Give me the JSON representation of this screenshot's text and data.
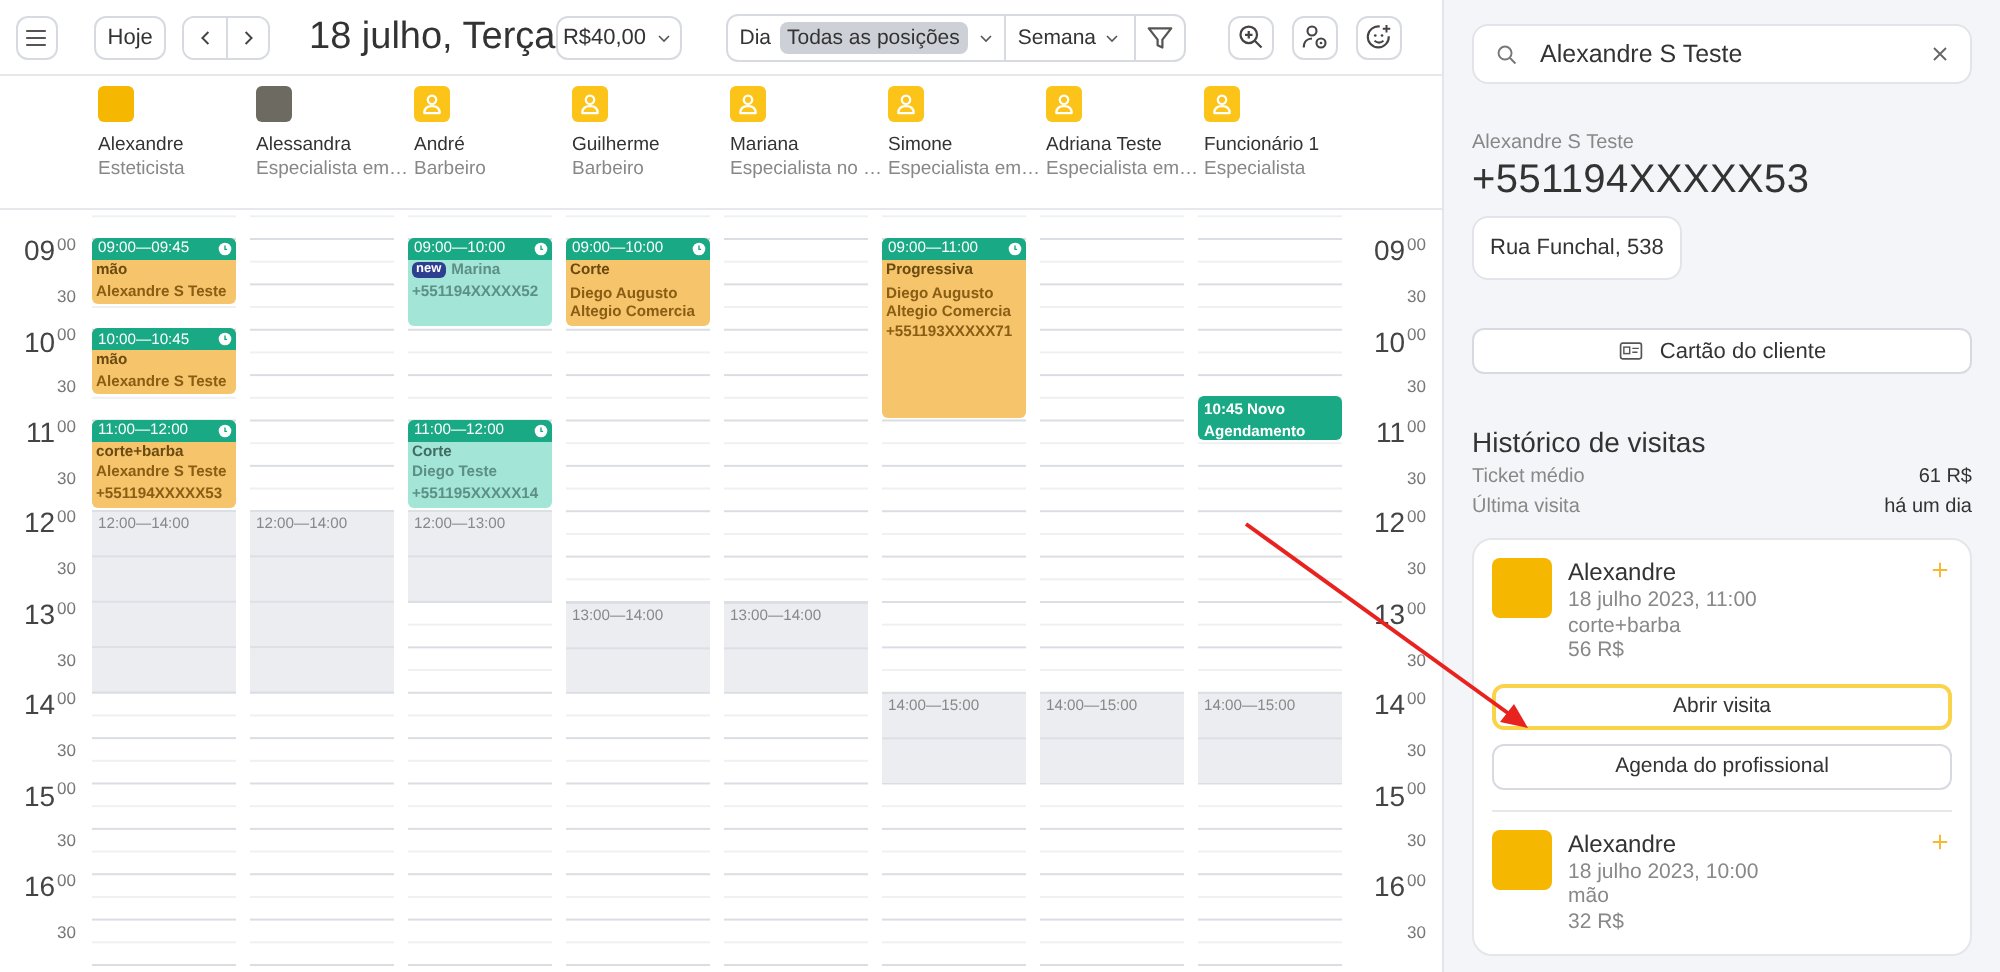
{
  "toolbar": {
    "today": "Hoje",
    "date_title": "18 julho, Terça",
    "price_filter": "R$40,00",
    "view_options": [
      {
        "label": "Dia",
        "selected": false
      },
      {
        "label": "Todas as posições",
        "selected": true
      }
    ],
    "period": "Semana"
  },
  "staff": [
    {
      "name": "Alexandre",
      "role": "Esteticista",
      "kind": "photo"
    },
    {
      "name": "Alessandra",
      "role": "Especialista em…",
      "kind": "photo"
    },
    {
      "name": "André",
      "role": "Barbeiro",
      "kind": "placeholder"
    },
    {
      "name": "Guilherme",
      "role": "Barbeiro",
      "kind": "placeholder"
    },
    {
      "name": "Mariana",
      "role": "Especialista no …",
      "kind": "placeholder"
    },
    {
      "name": "Simone",
      "role": "Especialista em…",
      "kind": "placeholder"
    },
    {
      "name": "Adriana Teste",
      "role": "Especialista em…",
      "kind": "placeholder"
    },
    {
      "name": "Funcionário 1",
      "role": "Especialista",
      "kind": "placeholder"
    }
  ],
  "schedule": {
    "time_axis_left": [
      {
        "kind": "hour",
        "hour": "09",
        "minutes": "00"
      },
      {
        "kind": "half",
        "minutes": "30"
      },
      {
        "kind": "hour",
        "hour": "10",
        "minutes": "00"
      },
      {
        "kind": "half",
        "minutes": "30"
      },
      {
        "kind": "hour",
        "hour": "11",
        "minutes": "00"
      },
      {
        "kind": "half",
        "minutes": "30"
      },
      {
        "kind": "hour",
        "hour": "12",
        "minutes": "00"
      },
      {
        "kind": "half",
        "minutes": "30"
      },
      {
        "kind": "hour",
        "hour": "13",
        "minutes": "00"
      },
      {
        "kind": "half",
        "minutes": "30"
      },
      {
        "kind": "hour",
        "hour": "14",
        "minutes": "00"
      },
      {
        "kind": "half",
        "minutes": "30"
      },
      {
        "kind": "hour",
        "hour": "15",
        "minutes": "00"
      },
      {
        "kind": "half",
        "minutes": "30"
      },
      {
        "kind": "hour",
        "hour": "16",
        "minutes": "00"
      },
      {
        "kind": "half",
        "minutes": "30"
      }
    ],
    "time_axis_right": [
      {
        "kind": "hour",
        "hour": "09",
        "minutes": "00"
      },
      {
        "kind": "half",
        "minutes": "30"
      },
      {
        "kind": "hour",
        "hour": "10",
        "minutes": "00"
      },
      {
        "kind": "half",
        "minutes": "30"
      },
      {
        "kind": "hour",
        "hour": "11",
        "minutes": "00"
      },
      {
        "kind": "half",
        "minutes": "30"
      },
      {
        "kind": "hour",
        "hour": "12",
        "minutes": "00"
      },
      {
        "kind": "half",
        "minutes": "30"
      },
      {
        "kind": "hour",
        "hour": "13",
        "minutes": "00"
      },
      {
        "kind": "half",
        "minutes": "30"
      },
      {
        "kind": "hour",
        "hour": "14",
        "minutes": "00"
      },
      {
        "kind": "half",
        "minutes": "30"
      },
      {
        "kind": "hour",
        "hour": "15",
        "minutes": "00"
      },
      {
        "kind": "half",
        "minutes": "30"
      },
      {
        "kind": "hour",
        "hour": "16",
        "minutes": "00"
      },
      {
        "kind": "half",
        "minutes": "30"
      }
    ],
    "columns": [
      {
        "events": [
          {
            "kind": "appointment",
            "time": "09:00—09:45",
            "color": "#f6c46b",
            "service": "mão",
            "client": "Alexandre S Teste"
          },
          {
            "kind": "appointment",
            "time": "10:00—10:45",
            "color": "#f6c46b",
            "service": "mão",
            "client": "Alexandre S Teste"
          },
          {
            "kind": "appointment",
            "time": "11:00—12:00",
            "color": "#f6c46b",
            "service": "corte+barba",
            "client": "Alexandre S Teste",
            "phone": "+551194XXXXX53"
          },
          {
            "kind": "break",
            "time": "12:00—14:00"
          }
        ]
      },
      {
        "events": [
          {
            "kind": "break",
            "time": "12:00—14:00"
          }
        ]
      },
      {
        "events": [
          {
            "kind": "appointment",
            "time": "09:00—10:00",
            "color": "#a3e6d7",
            "badge": "new",
            "client": "Marina",
            "phone": "+551194XXXXX52"
          },
          {
            "kind": "appointment",
            "time": "11:00—12:00",
            "color": "#a3e6d7",
            "service": "Corte",
            "client": "Diego Teste",
            "phone": "+551195XXXXX14"
          },
          {
            "kind": "break",
            "time": "12:00—13:00"
          }
        ]
      },
      {
        "events": [
          {
            "kind": "appointment",
            "time": "09:00—10:00",
            "color": "#f6c46b",
            "service": "Corte",
            "client": "Diego Augusto Altegio Comercia"
          },
          {
            "kind": "break",
            "time": "13:00—14:00"
          }
        ]
      },
      {
        "events": [
          {
            "kind": "break",
            "time": "13:00—14:00"
          }
        ]
      },
      {
        "events": [
          {
            "kind": "appointment",
            "time": "09:00—11:00",
            "color": "#f6c46b",
            "service": "Progressiva",
            "client": "Diego Augusto Altegio Comercia",
            "phone": "+551193XXXXX71"
          },
          {
            "kind": "break",
            "time": "14:00—15:00"
          }
        ]
      },
      {
        "events": [
          {
            "kind": "break",
            "time": "14:00—15:00"
          }
        ]
      },
      {
        "events": [
          {
            "kind": "new",
            "time": "10:45 Novo Agendamento"
          },
          {
            "kind": "break",
            "time": "14:00—15:00"
          }
        ]
      }
    ]
  },
  "client": {
    "search_value": "Alexandre S Teste",
    "name": "Alexandre S Teste",
    "phone": "+551194XXXXX53",
    "address": "Rua Funchal, 538",
    "card_button": "Cartão do cliente"
  },
  "history": {
    "title": "Histórico de visitas",
    "stats": [
      {
        "label": "Ticket médio",
        "value": "61 R$"
      },
      {
        "label": "Última visita",
        "value": "há um dia"
      }
    ],
    "visits": [
      {
        "staff": "Alexandre",
        "date": "18 julho 2023, 11:00",
        "service": "corte+barba",
        "price": "56 R$",
        "buttons": [
          {
            "label": "Abrir visita",
            "highlighted": true
          },
          {
            "label": "Agenda do profissional",
            "highlighted": false
          }
        ]
      },
      {
        "staff": "Alexandre",
        "date": "18 julho 2023, 10:00",
        "service": "mão",
        "price": "32 R$"
      }
    ]
  }
}
